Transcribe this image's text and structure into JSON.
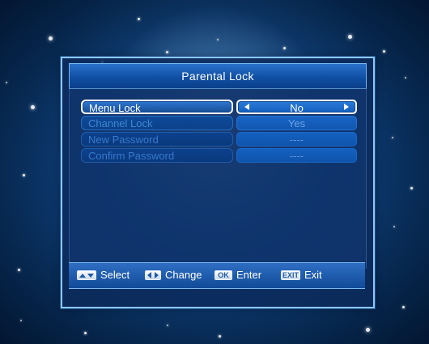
{
  "dialog": {
    "title": "Parental Lock",
    "rows": [
      {
        "label": "Menu Lock",
        "value": "No"
      },
      {
        "label": "Channel Lock",
        "value": "Yes"
      },
      {
        "label": "New Password",
        "value": "----"
      },
      {
        "label": "Confirm Password",
        "value": "----"
      }
    ]
  },
  "footer": {
    "select_label": "Select",
    "change_label": "Change",
    "ok_key": "OK",
    "enter_label": "Enter",
    "exit_key": "EXIT",
    "exit_label": "Exit"
  }
}
